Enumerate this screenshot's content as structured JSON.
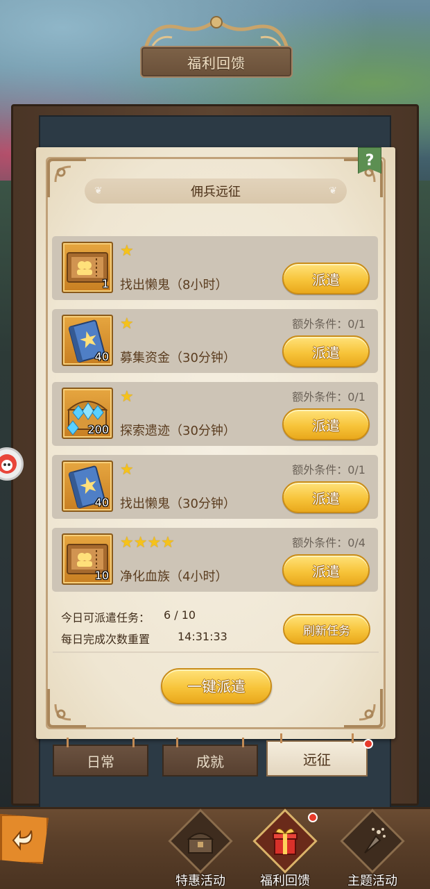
{
  "top_title": "福利回馈",
  "panel_title": "佣兵远征",
  "help_label": "?",
  "tasks": [
    {
      "stars": "★",
      "count": "1",
      "name": "找出懒鬼（8小时）",
      "extra": "",
      "button": "派遣",
      "icon": "ticket-icon"
    },
    {
      "stars": "★",
      "count": "40",
      "name": "募集资金（30分钟）",
      "extra": "额外条件：0/1",
      "button": "派遣",
      "icon": "blue-book-icon"
    },
    {
      "stars": "★",
      "count": "200",
      "name": "探索遗迹（30分钟）",
      "extra": "额外条件：0/1",
      "button": "派遣",
      "icon": "diamond-chest-icon"
    },
    {
      "stars": "★",
      "count": "40",
      "name": "找出懒鬼（30分钟）",
      "extra": "额外条件：0/1",
      "button": "派遣",
      "icon": "blue-book-icon"
    },
    {
      "stars": "★★★★",
      "count": "10",
      "name": "净化血族（4小时）",
      "extra": "额外条件：0/4",
      "button": "派遣",
      "icon": "ticket-icon"
    }
  ],
  "daily": {
    "dispatch_label": "今日可派遣任务：",
    "dispatch_value": "6 / 10",
    "reset_label": "每日完成次数重置",
    "reset_time": "14:31:33"
  },
  "refresh_button": "刷新任务",
  "onekey_button": "一键派遣",
  "tabs": [
    {
      "label": "日常"
    },
    {
      "label": "成就"
    },
    {
      "label": "远征",
      "active": true
    }
  ],
  "bottom_nav": [
    {
      "label": "特惠活动",
      "icon": "treasure-chest-icon"
    },
    {
      "label": "福利回馈",
      "icon": "gift-box-icon",
      "active": true
    },
    {
      "label": "主题活动",
      "icon": "firework-icon"
    }
  ],
  "colors": {
    "accent_gold": "#f7c43a",
    "paper": "#efe6d2",
    "row_bg": "#cdc4b6",
    "notification": "#e83a2a"
  }
}
